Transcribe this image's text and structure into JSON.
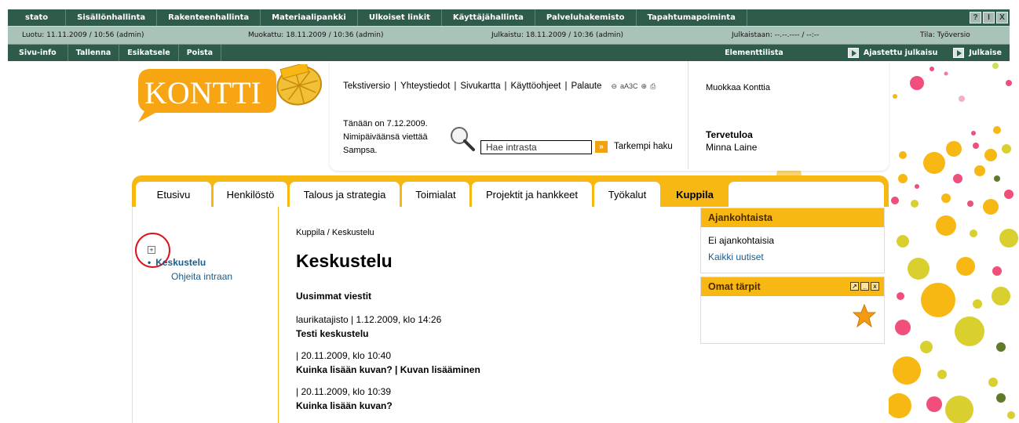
{
  "admin_menu": {
    "items": [
      "stato",
      "Sisällönhallinta",
      "Rakenteenhallinta",
      "Materiaalipankki",
      "Ulkoiset linkit",
      "Käyttäjähallinta",
      "Palveluhakemisto",
      "Tapahtumapoiminta"
    ],
    "window_buttons": [
      "?",
      "I",
      "X"
    ]
  },
  "info_bar": {
    "loaded": "Luotu: 11.11.2009 / 10:56 (admin)",
    "modified": "Muokattu: 18.11.2009 / 10:36 (admin)",
    "published": "Julkaistu: 18.11.2009 / 10:36 (admin)",
    "to_publish": "Julkaistaan: --.--.---- / --:--",
    "state": "Tila: Työversio"
  },
  "toolbar": {
    "items": [
      "Sivu-info",
      "Tallenna",
      "Esikatsele",
      "Poista"
    ],
    "elements_list": "Elementtilista",
    "scheduled_publish": "Ajastettu julkaisu",
    "publish": "Julkaise"
  },
  "header": {
    "logo_text": "KONTTI",
    "top_links": [
      "Tekstiversio",
      "Yhteystiedot",
      "Sivukartta",
      "Käyttöohjeet",
      "Palaute"
    ],
    "text_size_label": "aA3C",
    "date_line": "Tänään on 7.12.2009.",
    "nameday_line": "Nimipäiväänsä viettää Sampsa.",
    "search_placeholder": "Hae intrasta",
    "search_go": "»",
    "advanced_search": "Tarkempi haku",
    "edit_link": "Muokkaa Konttia",
    "welcome": "Tervetuloa",
    "user_name": "Minna Laine"
  },
  "tabs": [
    "Etusivu",
    "Henkilöstö",
    "Talous ja strategia",
    "Toimialat",
    "Projektit ja hankkeet",
    "Työkalut",
    "Kuppila"
  ],
  "left_nav": {
    "expander": "+",
    "selected": "Keskustelu",
    "child": "Ohjeita intraan"
  },
  "main": {
    "breadcrumb": "Kuppila / Keskustelu",
    "title": "Keskustelu",
    "latest_heading": "Uusimmat viestit",
    "posts": [
      {
        "meta": "laurikatajisto | 1.12.2009, klo 14:26",
        "title": "Testi keskustelu"
      },
      {
        "meta": "| 20.11.2009, klo 10:40",
        "title": "Kuinka lisään kuvan? | Kuvan lisääminen"
      },
      {
        "meta": "| 20.11.2009, klo 10:39",
        "title": "Kuinka lisään kuvan?"
      }
    ]
  },
  "sidebar": {
    "news": {
      "title": "Ajankohtaista",
      "empty": "Ei ajankohtaisia",
      "all": "Kaikki uutiset"
    },
    "picks": {
      "title": "Omat tärpit",
      "controls": [
        "↗",
        "_",
        "x"
      ]
    }
  },
  "colors": {
    "admin_green": "#2f5b4b",
    "info_green": "#a9c3b9",
    "brand_yellow": "#f7b814",
    "link_blue": "#1b5c88",
    "highlight_red": "#d9141b"
  }
}
